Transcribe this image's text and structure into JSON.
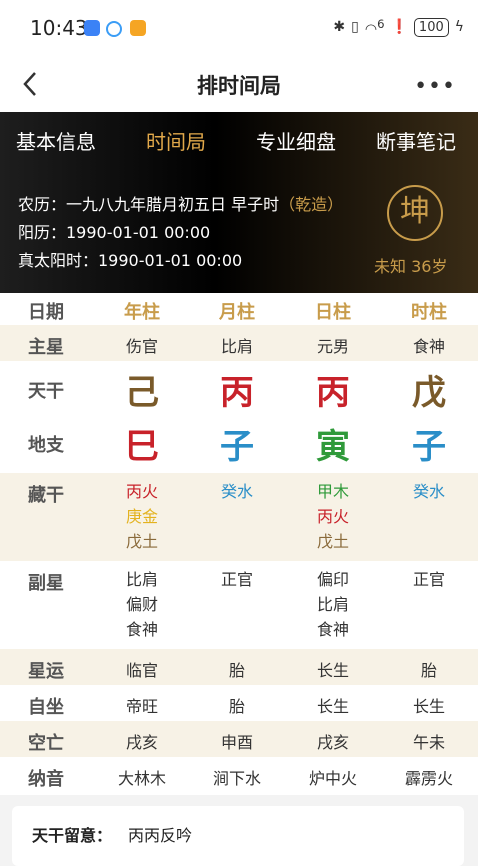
{
  "status": {
    "time": "10:43",
    "battery": "100",
    "signal": "6"
  },
  "header": {
    "title": "排时间局"
  },
  "tabs": [
    {
      "label": "基本信息"
    },
    {
      "label": "时间局"
    },
    {
      "label": "专业细盘"
    },
    {
      "label": "断事笔记"
    }
  ],
  "info": {
    "lunar": "农历：一九八九年腊月初五日 早子时",
    "gender": "（乾造）",
    "solar": "阳历：1990-01-01 00:00",
    "true_solar": "真太阳时：1990-01-01 00:00",
    "seal": "坤",
    "age": "未知  36岁"
  },
  "table": {
    "labels": {
      "date": "日期",
      "main_star": "主星",
      "tiangan": "天干",
      "dizhi": "地支",
      "canggan": "藏干",
      "fuxing": "副星",
      "xingyun": "星运",
      "zizuo": "自坐",
      "kongwang": "空亡",
      "nayin": "纳音"
    },
    "pillars": [
      "年柱",
      "月柱",
      "日柱",
      "时柱"
    ],
    "main_star": [
      "伤官",
      "比肩",
      "元男",
      "食神"
    ],
    "tiangan": [
      {
        "char": "己",
        "color": "#7a5a2a"
      },
      {
        "char": "丙",
        "color": "#c8222a"
      },
      {
        "char": "丙",
        "color": "#c8222a"
      },
      {
        "char": "戊",
        "color": "#7a5a2a"
      }
    ],
    "dizhi": [
      {
        "char": "巳",
        "color": "#c8222a"
      },
      {
        "char": "子",
        "color": "#2a8ec8"
      },
      {
        "char": "寅",
        "color": "#2f9a3a"
      },
      {
        "char": "子",
        "color": "#2a8ec8"
      }
    ],
    "canggan": [
      [
        {
          "t": "丙火",
          "color": "#c8222a"
        },
        {
          "t": "庚金",
          "color": "#e3b21f"
        },
        {
          "t": "戊土",
          "color": "#8a6a3a"
        }
      ],
      [
        {
          "t": "癸水",
          "color": "#2a8ec8"
        }
      ],
      [
        {
          "t": "甲木",
          "color": "#2f9a3a"
        },
        {
          "t": "丙火",
          "color": "#c8222a"
        },
        {
          "t": "戊土",
          "color": "#8a6a3a"
        }
      ],
      [
        {
          "t": "癸水",
          "color": "#2a8ec8"
        }
      ]
    ],
    "fuxing": [
      [
        "比肩",
        "偏财",
        "食神"
      ],
      [
        "正官"
      ],
      [
        "偏印",
        "比肩",
        "食神"
      ],
      [
        "正官"
      ]
    ],
    "xingyun": [
      "临官",
      "胎",
      "长生",
      "胎"
    ],
    "zizuo": [
      "帝旺",
      "胎",
      "长生",
      "长生"
    ],
    "kongwang": [
      "戌亥",
      "申酉",
      "戌亥",
      "午未"
    ],
    "nayin": [
      "大林木",
      "涧下水",
      "炉中火",
      "霹雳火"
    ]
  },
  "note": {
    "key": "天干留意：",
    "value": "丙丙反吟"
  },
  "colors": {
    "gold": "#c89c4b",
    "active_tab": "#e2a94b",
    "tint_row": "#f7f2e6"
  }
}
